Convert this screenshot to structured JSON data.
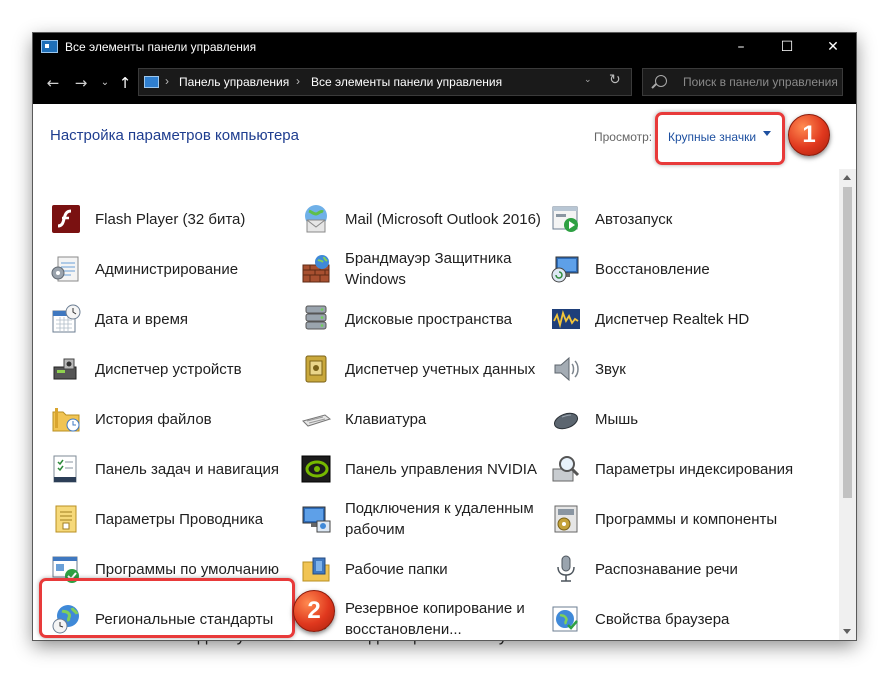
{
  "window": {
    "title": "Все элементы панели управления",
    "minimize": "–",
    "maximize": "☐",
    "close": "✕"
  },
  "nav": {
    "back": "←",
    "forward": "→",
    "recent": "⌄",
    "up": "↑",
    "breadcrumb": [
      "Панель управления",
      "Все элементы панели управления"
    ],
    "sep": "›",
    "dropdown": "⌄",
    "refresh": "↻",
    "search_placeholder": "Поиск в панели управления"
  },
  "content": {
    "heading": "Настройка параметров компьютера",
    "view_label": "Просмотр:",
    "view_value": "Крупные значки"
  },
  "items": [
    {
      "label": "Flash Player (32 бита)",
      "icon": "flash-player-icon"
    },
    {
      "label": "Mail (Microsoft Outlook 2016)",
      "icon": "mail-icon"
    },
    {
      "label": "Автозапуск",
      "icon": "autoplay-icon"
    },
    {
      "label": "Администрирование",
      "icon": "administrative-tools-icon"
    },
    {
      "label": "Брандмауэр Защитника Windows",
      "icon": "firewall-icon"
    },
    {
      "label": "Восстановление",
      "icon": "recovery-icon"
    },
    {
      "label": "Дата и время",
      "icon": "date-time-icon"
    },
    {
      "label": "Дисковые пространства",
      "icon": "storage-spaces-icon"
    },
    {
      "label": "Диспетчер Realtek HD",
      "icon": "realtek-icon"
    },
    {
      "label": "Диспетчер устройств",
      "icon": "device-manager-icon"
    },
    {
      "label": "Диспетчер учетных данных",
      "icon": "credential-manager-icon"
    },
    {
      "label": "Звук",
      "icon": "sound-icon"
    },
    {
      "label": "История файлов",
      "icon": "file-history-icon"
    },
    {
      "label": "Клавиатура",
      "icon": "keyboard-icon"
    },
    {
      "label": "Мышь",
      "icon": "mouse-icon"
    },
    {
      "label": "Панель задач и навигация",
      "icon": "taskbar-icon"
    },
    {
      "label": "Панель управления NVIDIA",
      "icon": "nvidia-icon"
    },
    {
      "label": "Параметры индексирования",
      "icon": "indexing-icon"
    },
    {
      "label": "Параметры Проводника",
      "icon": "explorer-options-icon"
    },
    {
      "label": "Подключения к удаленным рабочим",
      "icon": "remote-desktop-icon"
    },
    {
      "label": "Программы и компоненты",
      "icon": "programs-features-icon"
    },
    {
      "label": "Программы по умолчанию",
      "icon": "default-programs-icon"
    },
    {
      "label": "Рабочие папки",
      "icon": "work-folders-icon"
    },
    {
      "label": "Распознавание речи",
      "icon": "speech-recognition-icon"
    },
    {
      "label": "Региональные стандарты",
      "icon": "region-icon"
    },
    {
      "label": "Резервное копирование и восстановлени...",
      "icon": "backup-icon"
    },
    {
      "label": "Свойства браузера",
      "icon": "internet-options-icon"
    }
  ],
  "callouts": [
    {
      "number": "1"
    },
    {
      "number": "2"
    }
  ],
  "background_text": "Сдвинутый в бок выпадающих меню пункт «Региональные»",
  "colors": {
    "titlebar": "#000000",
    "heading": "#1e3d8f",
    "link": "#1e50a0",
    "callout": "#e83a3a"
  }
}
